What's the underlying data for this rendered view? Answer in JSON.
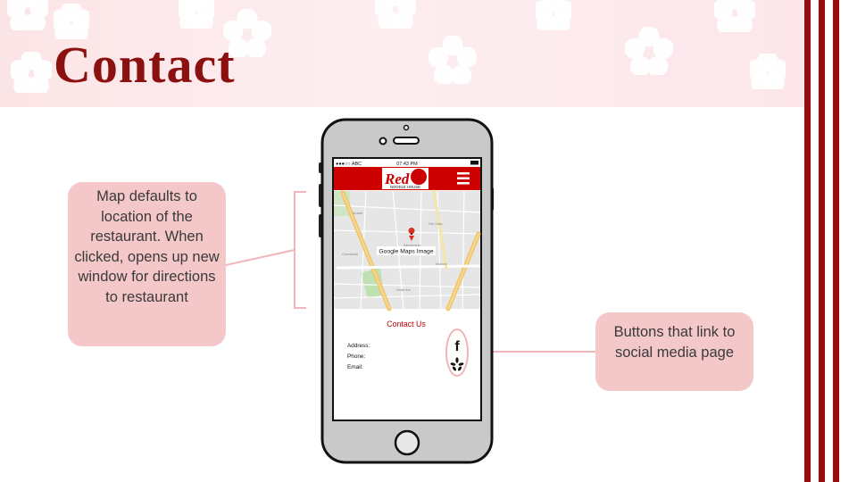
{
  "slide": {
    "title": "Contact",
    "colors": {
      "accent": "#9e0b0f",
      "callout_bg": "#f4c7c9",
      "header_bg": "#fbe4e6"
    }
  },
  "callouts": {
    "map": "Map defaults to location of the restaurant. When clicked, opens up new window for directions to restaurant",
    "social": "Buttons that link to social media page"
  },
  "phone": {
    "status_bar": {
      "carrier": "●●●○○ ABC",
      "time": "07:43 PM"
    },
    "header": {
      "logo_main": "Red",
      "logo_sub": "NOODLE HOUSE",
      "menu_icon": "hamburger-icon",
      "bg_color": "#cc0000"
    },
    "map": {
      "label": "Google Maps Image",
      "pin_icon": "map-pin-icon"
    },
    "contact": {
      "heading": "Contact Us",
      "address_label": "Address:",
      "phone_label": "Phone:",
      "email_label": "Email:"
    },
    "social_icons": [
      "facebook-icon",
      "yelp-icon"
    ]
  }
}
